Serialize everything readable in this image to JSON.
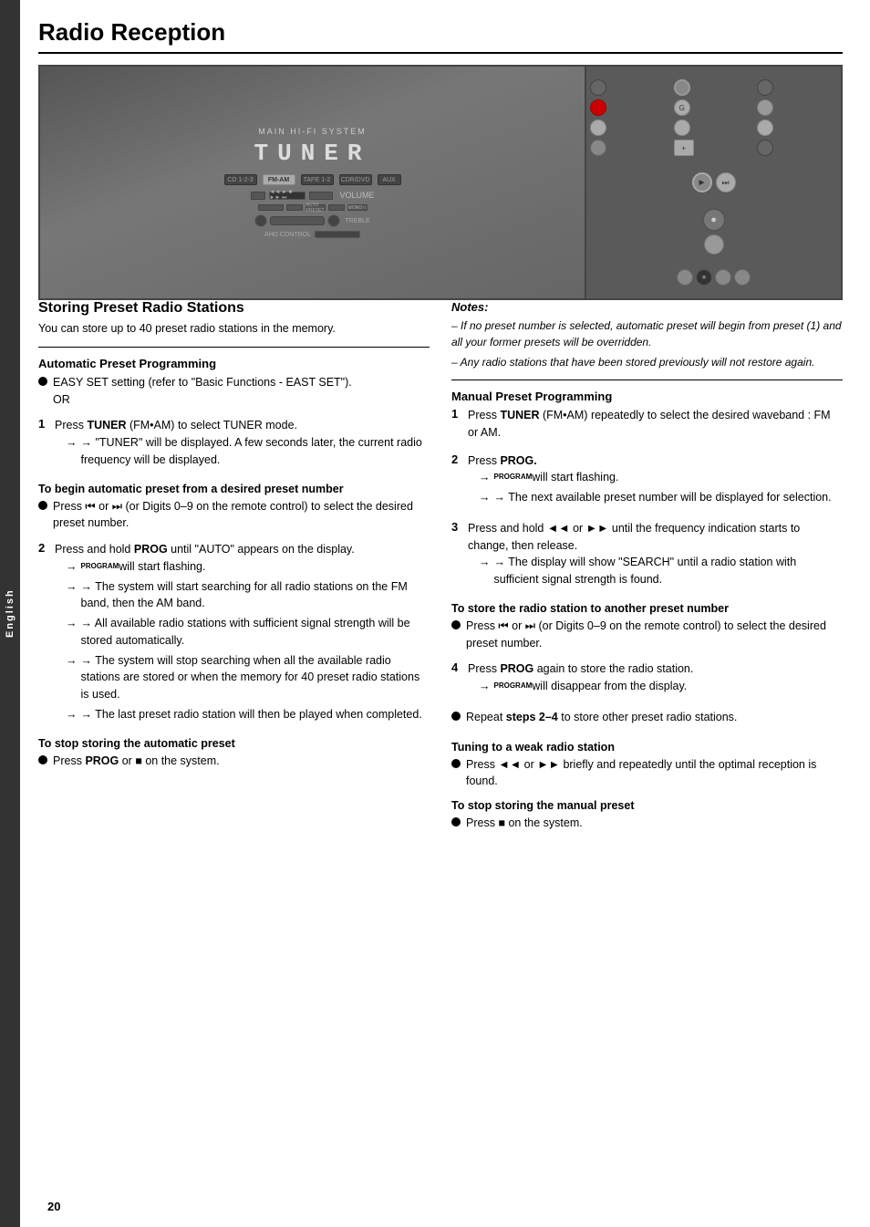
{
  "page": {
    "title": "Radio Reception",
    "side_tab": "English",
    "page_number": "20"
  },
  "device_image": {
    "label": "TUNER"
  },
  "storing_section": {
    "title": "Storing Preset Radio Stations",
    "intro": "You can store up to 40 preset radio stations in the memory."
  },
  "auto_preset": {
    "title": "Automatic Preset Programming",
    "bullet1_text": "EASY SET setting (refer to \"Basic Functions - EAST SET\").",
    "bullet1_or": "OR",
    "step1_label": "1",
    "step1_text": "Press ",
    "step1_bold": "TUNER",
    "step1_suffix": " (FM•AM) to select TUNER mode.",
    "step1_arrow1": "→ \"TUNER\" will be displayed. A few seconds later, the current radio frequency will be displayed.",
    "step1_sub_heading": "To begin automatic preset from a desired preset number",
    "step1_bullet": "Press ⏮ or ⏭ (or Digits 0–9 on the remote control) to select the desired preset number.",
    "step2_label": "2",
    "step2_text": "Press and hold ",
    "step2_bold": "PROG",
    "step2_suffix": " until \"AUTO\" appears on the display.",
    "step2_arrow1": "→ PROGRAM will start flashing.",
    "step2_arrow2": "→ The system will start searching for all radio stations on the FM band, then the AM band.",
    "step2_arrow3": "→ All available radio stations with sufficient signal strength will be stored automatically.",
    "step2_arrow4": "→ The system will stop searching when all the available radio stations are stored or when the memory for 40 preset radio stations is used.",
    "step2_arrow5": "→ The last preset radio station will then be played when completed.",
    "stop_heading": "To stop storing the automatic preset",
    "stop_text": "Press ",
    "stop_bold": "PROG",
    "stop_suffix": " or ■ on the system."
  },
  "notes": {
    "title": "Notes:",
    "note1": "– If no preset number is selected, automatic preset will begin from preset (1) and all your former presets will be overridden.",
    "note2": "– Any radio stations that have been stored previously will not restore again."
  },
  "manual_preset": {
    "title": "Manual Preset Programming",
    "step1_label": "1",
    "step1_text": "Press ",
    "step1_bold": "TUNER",
    "step1_suffix": " (FM•AM) repeatedly to select the desired waveband : FM or AM.",
    "step2_label": "2",
    "step2_text": "Press ",
    "step2_bold": "PROG.",
    "step2_arrow1": "→ PROGRAM will start flashing.",
    "step2_arrow2": "→ The next available preset number will be displayed for selection.",
    "step3_label": "3",
    "step3_text": "Press and hold ◄◄ or ►► until the frequency indication starts to change, then release.",
    "step3_arrow1": "→ The display will show \"SEARCH\" until a radio station with sufficient signal strength is found.",
    "step3_sub_heading": "To store the radio station to another preset number",
    "step3_bullet": "Press ⏮ or ⏭ (or Digits 0–9 on the remote control) to select the desired preset number.",
    "step4_label": "4",
    "step4_text": "Press ",
    "step4_bold": "PROG",
    "step4_suffix": " again to store the radio station.",
    "step4_arrow1": "→ PROGRAM will disappear from the display.",
    "repeat_bullet": "Repeat steps 2–4 to store other preset radio stations.",
    "tuning_title": "Tuning to a weak radio station",
    "tuning_bullet": "Press ◄◄ or ►► briefly and repeatedly until the optimal reception is found.",
    "stop_title": "To stop storing the manual preset",
    "stop_bullet": "Press ■ on the system."
  }
}
